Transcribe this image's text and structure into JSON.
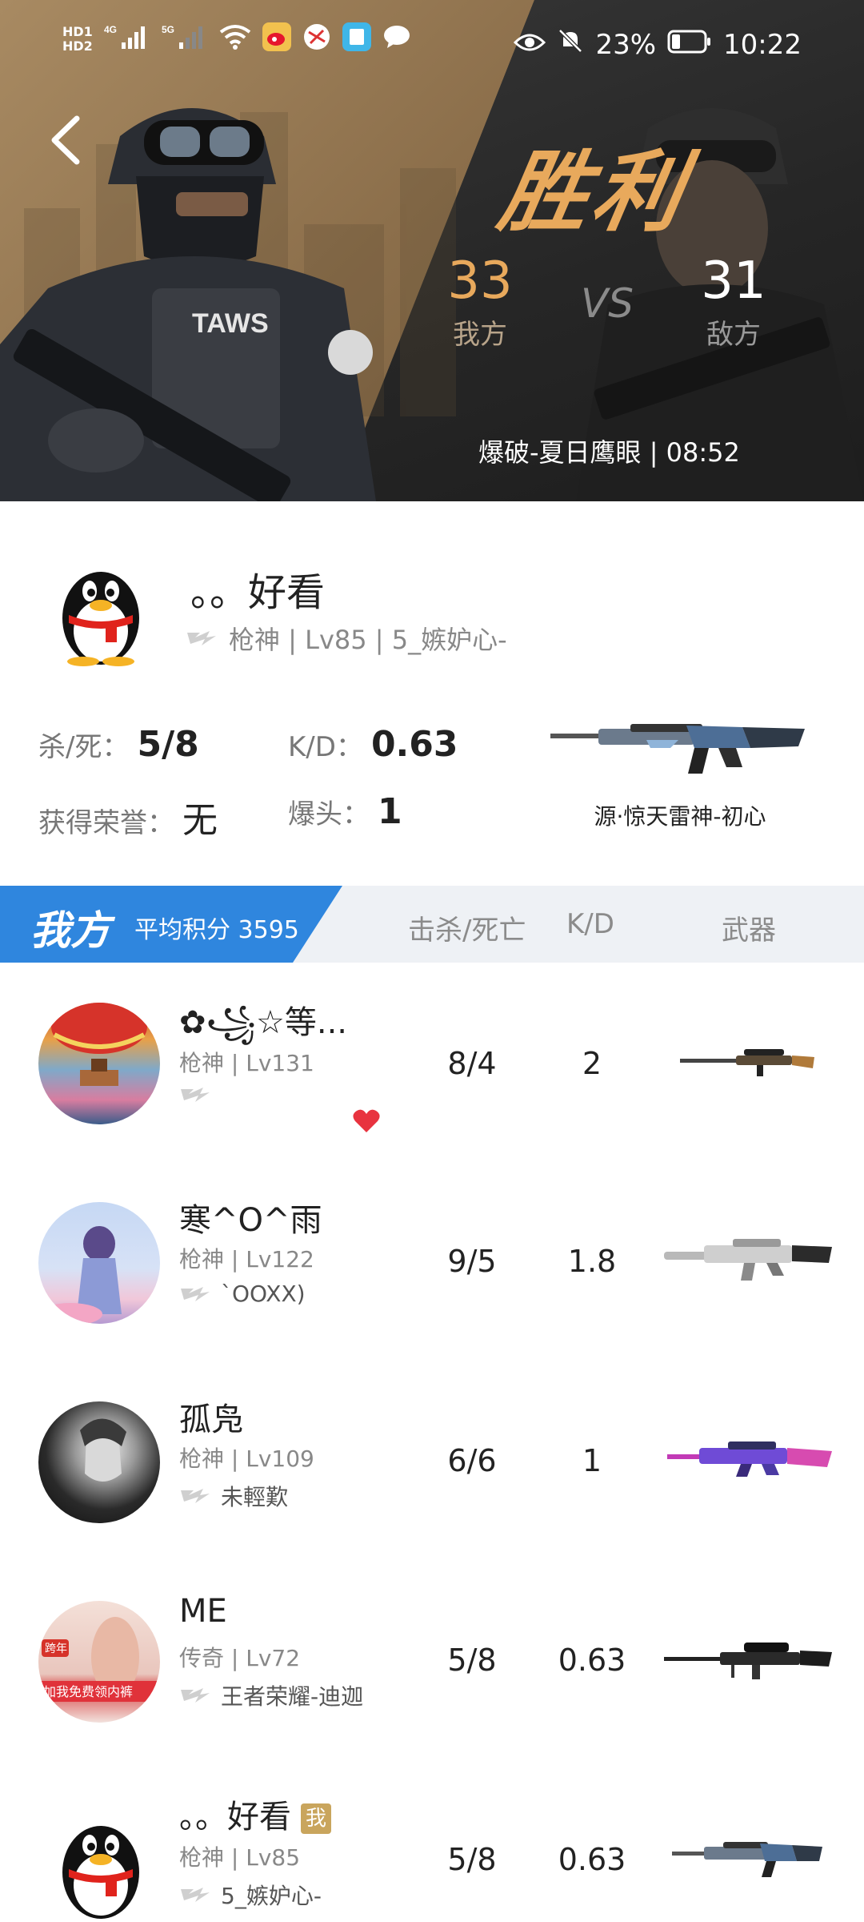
{
  "status_bar": {
    "left_labels": [
      "HD1",
      "4G",
      "5G",
      "HD2"
    ],
    "battery": "23%",
    "time": "10:22"
  },
  "hero": {
    "result": "胜利",
    "our_score": "33",
    "our_label": "我方",
    "vs": "VS",
    "enemy_score": "31",
    "enemy_label": "敌方",
    "match_info": "爆破-夏日鹰眼 | 08:52",
    "soldier_badge": "TAWS",
    "colors": {
      "accent": "#e8a95c",
      "gold_bg": "#8c6f4b",
      "dark_bg": "#262626"
    }
  },
  "profile": {
    "name": "。。好看",
    "subtitle": "枪神 | Lv85 | 5_嫉妒心-",
    "kill_death_label": "杀/死：",
    "kill_death_value": "5/8",
    "kd_label": "K/D：",
    "kd_value": "0.63",
    "honor_label": "获得荣誉：",
    "honor_value": "无",
    "headshot_label": "爆头：",
    "headshot_value": "1",
    "weapon_name": "源·惊天雷神-初心"
  },
  "team": {
    "name": "我方",
    "avg_score": "平均积分 3595",
    "col_kill_death": "击杀/死亡",
    "col_kd": "K/D",
    "col_weapon": "武器",
    "colors": {
      "blue": "#2f86de",
      "header_bg": "#eef1f5"
    }
  },
  "players": [
    {
      "name": "✿꧁☆等...",
      "sub": "枪神 | Lv131",
      "extra": "",
      "kd": "8/4",
      "ratio": "2",
      "weapon_icon": "sniper-rifle-icon",
      "liked": true,
      "is_me": false
    },
    {
      "name": "寒^O^雨",
      "sub": "枪神 | Lv122",
      "extra": "`OOXX)",
      "kd": "9/5",
      "ratio": "1.8",
      "weapon_icon": "silver-rifle-icon",
      "liked": false,
      "is_me": false
    },
    {
      "name": "孤凫",
      "sub": "枪神 | Lv109",
      "extra": "未輕歎",
      "kd": "6/6",
      "ratio": "1",
      "weapon_icon": "purple-rifle-icon",
      "liked": false,
      "is_me": false
    },
    {
      "name": "ME",
      "sub": "传奇 | Lv72",
      "extra": "王者荣耀-迪迦",
      "kd": "5/8",
      "ratio": "0.63",
      "weapon_icon": "heavy-sniper-icon",
      "liked": false,
      "is_me": false
    },
    {
      "name": "。。好看",
      "sub": "枪神 | Lv85",
      "extra": "5_嫉妒心-",
      "kd": "5/8",
      "ratio": "0.63",
      "weapon_icon": "blue-rifle-icon",
      "liked": false,
      "is_me": true,
      "me_badge": "我"
    }
  ],
  "avatar_texts": {
    "player4": "加我免费领内裤",
    "player4_tag": "跨年"
  }
}
